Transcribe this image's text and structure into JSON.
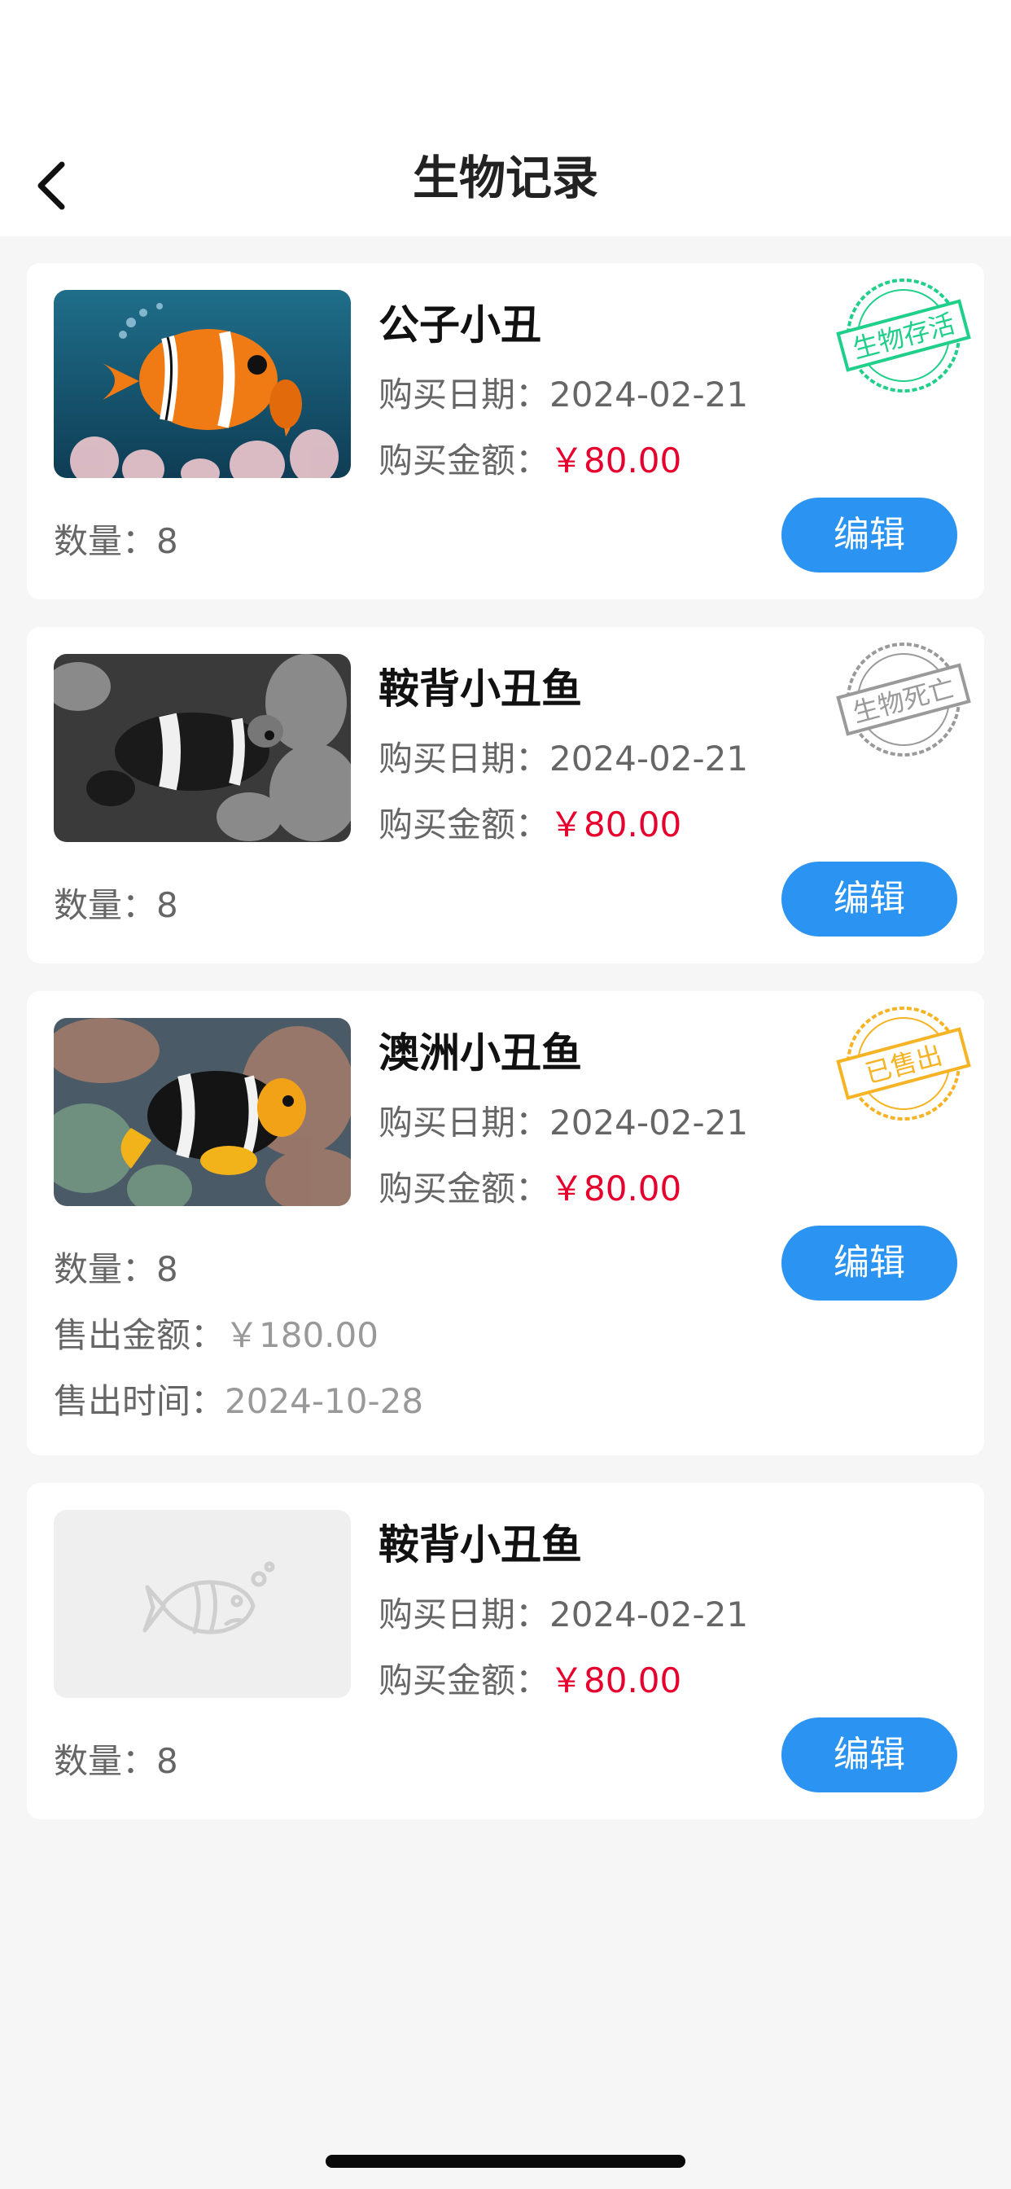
{
  "header": {
    "title": "生物记录"
  },
  "labels": {
    "purchase_date": "购买日期：",
    "purchase_amount": "购买金额：",
    "quantity": "数量：",
    "sold_amount": "售出金额：",
    "sold_time": "售出时间：",
    "edit": "编辑"
  },
  "records": [
    {
      "name": "公子小丑",
      "purchase_date": "2024-02-21",
      "purchase_amount": "￥80.00",
      "quantity": "8",
      "status": "生物存活",
      "status_color": "#1fcf8a",
      "image": "orange-clownfish-photo"
    },
    {
      "name": "鞍背小丑鱼",
      "purchase_date": "2024-02-21",
      "purchase_amount": "￥80.00",
      "quantity": "8",
      "status": "生物死亡",
      "status_color": "#9a9a9a",
      "image": "grayscale-clownfish-photo"
    },
    {
      "name": "澳洲小丑鱼",
      "purchase_date": "2024-02-21",
      "purchase_amount": "￥80.00",
      "quantity": "8",
      "status": "已售出",
      "status_color": "#f6b324",
      "image": "black-clownfish-photo",
      "sold_amount": "￥180.00",
      "sold_time": "2024-10-28"
    },
    {
      "name": "鞍背小丑鱼",
      "purchase_date": "2024-02-21",
      "purchase_amount": "￥80.00",
      "quantity": "8",
      "image": "placeholder-fish-icon"
    }
  ],
  "colors": {
    "accent": "#2b93f2",
    "price": "#e5002d",
    "background": "#f6f6f6"
  }
}
